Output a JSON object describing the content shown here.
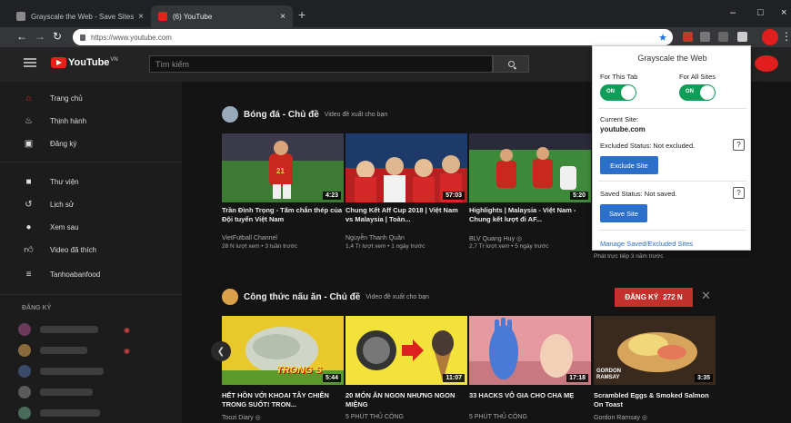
{
  "browser": {
    "tabs": [
      {
        "title": "Grayscale the Web - Save Sites",
        "active": false
      },
      {
        "title": "(6) YouTube",
        "active": true
      }
    ],
    "url": "https://www.youtube.com"
  },
  "youtube": {
    "logo": "YouTube",
    "logo_region": "VN",
    "search_placeholder": "Tìm kiếm"
  },
  "sidebar": {
    "items": [
      {
        "label": "Trang chủ",
        "icon": "home-icon",
        "active": true
      },
      {
        "label": "Thịnh hành",
        "icon": "fire-icon",
        "active": false
      },
      {
        "label": "Đăng ký",
        "icon": "subscriptions-icon",
        "active": false
      },
      {
        "label": "Thư viện",
        "icon": "folder-icon",
        "active": false
      },
      {
        "label": "Lịch sử",
        "icon": "history-icon",
        "active": false
      },
      {
        "label": "Xem sau",
        "icon": "clock-icon",
        "active": false
      },
      {
        "label": "Video đã thích",
        "icon": "thumbs-up-icon",
        "active": false
      },
      {
        "label": "Tanhoabanfood",
        "icon": "playlist-icon",
        "active": false
      }
    ],
    "subscriptions_heading": "ĐĂNG KÝ"
  },
  "sections": [
    {
      "title": "Bóng đá - Chủ đề",
      "subtitle": "Video đề xuất cho bạn",
      "videos": [
        {
          "title": "Trần Đình Trọng - Tấm chắn thép của Đội tuyển Việt Nam",
          "channel": "VietFutball Channel",
          "meta": "28 N lượt xem • 3 tuần trước",
          "duration": "4:23"
        },
        {
          "title": "Chung Kết Aff Cup 2018 | Việt Nam vs Malaysia | Toàn...",
          "channel": "Nguyễn Thanh Quân",
          "meta": "1,4 Tr lượt xem • 1 ngày trước",
          "duration": "57:03"
        },
        {
          "title": "Highlights | Malaysia - Việt Nam - Chung kết lượt đi AF...",
          "channel": "BLV Quang Huy ◎",
          "meta": "2,7 Tr lượt xem • 5 ngày trước",
          "duration": "5:20"
        }
      ]
    },
    {
      "title": "Công thức nấu ăn - Chủ đề",
      "subtitle": "Video đề xuất cho bạn",
      "subscribe_label": "ĐĂNG KÝ",
      "subscribe_count": "272 N",
      "videos": [
        {
          "title": "HẾT HỒN VỚI KHOAI TÂY CHIÊN TRONG SUỐT! TRON...",
          "channel": "Toozi Diary ◎",
          "duration": "5:44",
          "overlay": "TRONG S"
        },
        {
          "title": "20 MÓN ĂN NGON NHƯNG NGON MIỆNG",
          "channel": "5 PHÚT THỦ CÔNG",
          "duration": "11:07"
        },
        {
          "title": "33 HACKS VÔ GIA CHO CHA MẸ",
          "channel": "5 PHÚT THỦ CÔNG",
          "duration": "17:18"
        },
        {
          "title": "Scrambled Eggs & Smoked Salmon On Toast",
          "channel": "Gordon Ramsay ◎",
          "duration": "3:35",
          "overlay": "GORDON RAMSAY"
        }
      ]
    }
  ],
  "behind_popup_meta": "Phát trực tiếp 3 năm trước",
  "extension_popup": {
    "title": "Grayscale the Web",
    "for_this_tab": "For This Tab",
    "for_all_sites": "For All Sites",
    "toggle_on": "ON",
    "current_site_label": "Current Site:",
    "current_site": "youtube.com",
    "excluded_status": "Excluded Status: Not excluded.",
    "exclude_button": "Exclude Site",
    "saved_status": "Saved Status: Not saved.",
    "save_button": "Save Site",
    "help": "?",
    "manage_link": "Manage Saved/Excluded Sites"
  },
  "colors": {
    "youtube_red": "#e62117",
    "toggle_green": "#0f9d58",
    "button_blue": "#2a6fc9"
  }
}
